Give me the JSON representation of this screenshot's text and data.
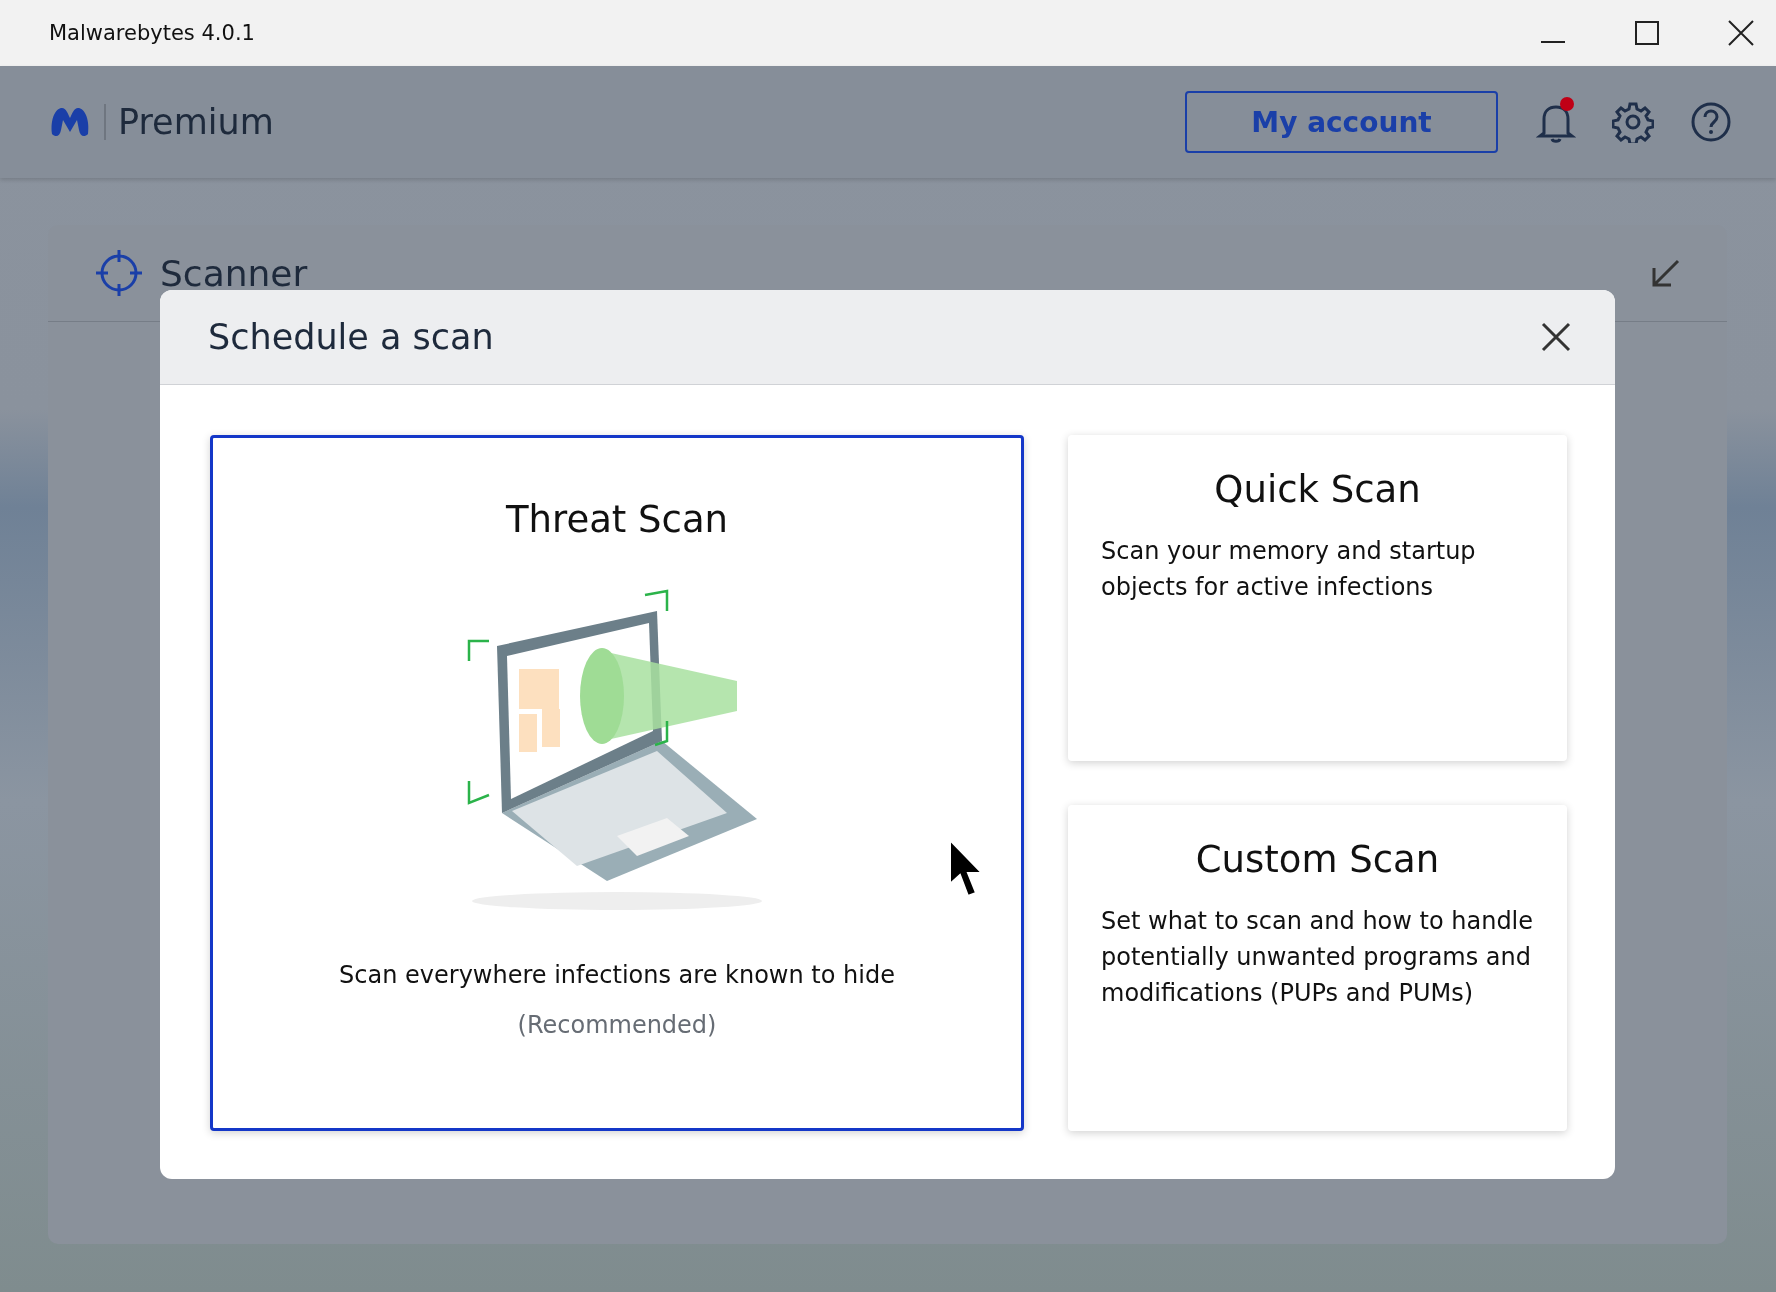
{
  "window": {
    "title": "Malwarebytes 4.0.1"
  },
  "header": {
    "product": "Premium",
    "account_button": "My account",
    "notifications": {
      "unread": true
    }
  },
  "panel": {
    "title": "Scanner"
  },
  "dialog": {
    "title": "Schedule a scan",
    "options": [
      {
        "kind": "featured",
        "title": "Threat Scan",
        "description": "Scan everywhere infections are known to hide",
        "note": "(Recommended)",
        "selected": true
      },
      {
        "kind": "plain",
        "title": "Quick Scan",
        "description": "Scan your memory and startup objects for active infections",
        "selected": false
      },
      {
        "kind": "plain",
        "title": "Custom Scan",
        "description": "Set what to scan and how to handle potentially unwanted programs and modifications (PUPs and PUMs)",
        "selected": false
      }
    ]
  }
}
